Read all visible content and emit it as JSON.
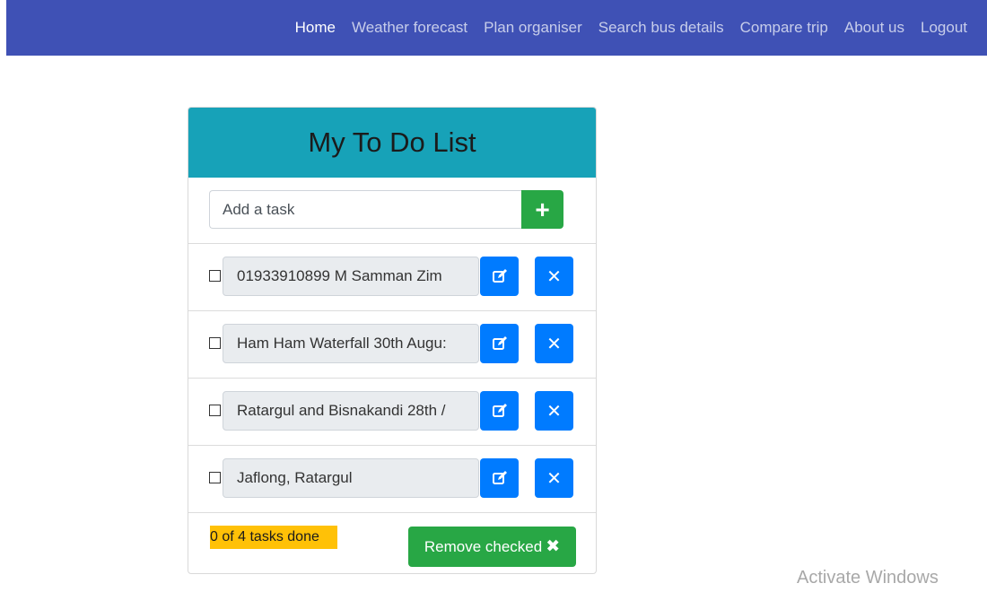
{
  "nav": {
    "links": [
      "Home",
      "Weather forecast",
      "Plan organiser",
      "Search bus details",
      "Compare trip",
      "About us",
      "Logout"
    ],
    "active": "Home"
  },
  "card": {
    "title": "My To Do List",
    "add_placeholder": "Add a task",
    "add_icon": "plus-icon",
    "tasks": [
      {
        "text": "01933910899 M Samman Zim",
        "checked": false
      },
      {
        "text": "Ham Ham Waterfall 30th Augu:",
        "checked": false
      },
      {
        "text": "Ratargul and Bisnakandi  28th /",
        "checked": false
      },
      {
        "text": "Jaflong, Ratargul",
        "checked": false
      }
    ],
    "done_text": "0 of 4 tasks done",
    "remove_label": "Remove checked",
    "remove_icon_char": "✖"
  },
  "colors": {
    "navbar": "#3f51b5",
    "header": "#17a2b8",
    "success": "#28a745",
    "primary": "#007bff",
    "warning": "#ffc107"
  },
  "watermark": "Activate Windows"
}
